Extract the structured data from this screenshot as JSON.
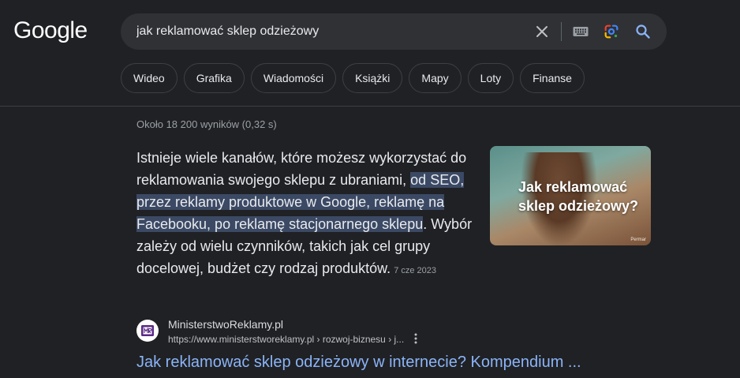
{
  "logo": {
    "text": "Google"
  },
  "search": {
    "query": "jak reklamować sklep odzieżowy",
    "clear_icon": "close-icon",
    "keyboard_icon": "keyboard-icon",
    "lens_icon": "google-lens-icon",
    "search_icon": "search-icon"
  },
  "chips": [
    "Wideo",
    "Grafika",
    "Wiadomości",
    "Książki",
    "Mapy",
    "Loty",
    "Finanse"
  ],
  "results_count": "Około 18 200 wyników (0,32 s) ",
  "snippet": {
    "before": "Istnieje wiele kanałów, które możesz wykorzystać do reklamowania swojego sklepu z ubraniami, ",
    "highlight": "od SEO, przez reklamy produktowe w Google, reklamę na Facebooku, po reklamę stacjonarnego sklepu",
    "after": ". Wybór zależy od wielu czynników, takich jak cel grupy docelowej, budżet czy rodzaj produktów.",
    "date": "7 cze 2023"
  },
  "thumbnail": {
    "text": "Jak reklamować sklep odzieżowy?",
    "brand": "Permar"
  },
  "source": {
    "site_name": "MinisterstwoReklamy.pl",
    "url": "https://www.ministerstworeklamy.pl › rozwoj-biznesu › j...",
    "menu_icon": "more-vert-icon"
  },
  "result_title": "Jak reklamować sklep odzieżowy w internecie? Kompendium ...",
  "colors": {
    "background": "#202124",
    "link": "#8ab4f8",
    "highlight": "#3b4964"
  }
}
